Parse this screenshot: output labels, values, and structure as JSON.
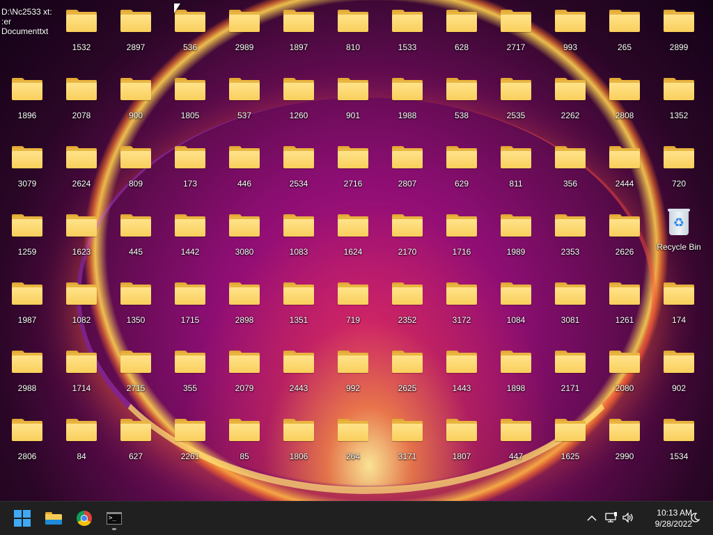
{
  "desktop": {
    "text_file": {
      "line1": "D:\\Nc2533 xt: :er",
      "line2": "Documenttxt"
    },
    "recycle_bin": {
      "label": "Recycle Bin"
    },
    "folders": [
      [
        "1532",
        "2897",
        "536",
        "2989",
        "1897",
        "810",
        "1533",
        "628",
        "2717",
        "993",
        "265",
        "2899"
      ],
      [
        "1896",
        "2078",
        "900",
        "1805",
        "537",
        "1260",
        "901",
        "1988",
        "538",
        "2535",
        "2262",
        "2808",
        "1352"
      ],
      [
        "3079",
        "2624",
        "809",
        "173",
        "446",
        "2534",
        "2716",
        "2807",
        "629",
        "811",
        "356",
        "2444",
        "720"
      ],
      [
        "1259",
        "1623",
        "445",
        "1442",
        "3080",
        "1083",
        "1624",
        "2170",
        "1716",
        "1989",
        "2353",
        "2626"
      ],
      [
        "1987",
        "1082",
        "1350",
        "1715",
        "2898",
        "1351",
        "719",
        "2352",
        "3172",
        "1084",
        "3081",
        "1261",
        "174"
      ],
      [
        "2988",
        "1714",
        "2715",
        "355",
        "2079",
        "2443",
        "992",
        "2625",
        "1443",
        "1898",
        "2171",
        "2080",
        "902"
      ],
      [
        "2806",
        "84",
        "627",
        "2261",
        "85",
        "1806",
        "264",
        "3171",
        "1807",
        "447",
        "1625",
        "2990",
        "1534"
      ]
    ]
  },
  "taskbar": {
    "start": "start-icon",
    "apps": [
      "file-explorer-icon",
      "chrome-icon",
      "terminal-icon"
    ],
    "tray": {
      "chevron": "^",
      "network": "network-icon",
      "volume": "volume-icon",
      "time": "10:13 AM",
      "date": "9/28/2022",
      "focus": "focus-assist-icon"
    }
  }
}
